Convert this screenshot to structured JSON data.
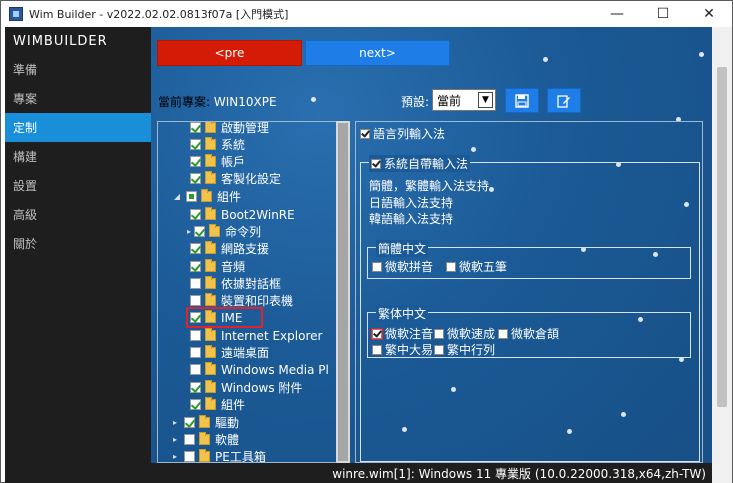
{
  "window": {
    "title": "Wim Builder - v2022.02.02.0813f07a [入門模式]",
    "controls": {
      "minimize": "—",
      "maximize": "☐",
      "close": "✕"
    }
  },
  "sidebar": {
    "brand": "WIMBUILDER",
    "items": [
      {
        "label": "準備",
        "active": false
      },
      {
        "label": "專案",
        "active": false
      },
      {
        "label": "定制",
        "active": true
      },
      {
        "label": "構建",
        "active": false
      },
      {
        "label": "設置",
        "active": false
      },
      {
        "label": "高級",
        "active": false
      },
      {
        "label": "關於",
        "active": false
      }
    ]
  },
  "toolbar": {
    "pre_label": "<pre",
    "next_label": "next>",
    "project_prefix": "當前專案:",
    "project_name": "WIN10XPE",
    "preset_label": "預設:",
    "preset_value": "當前",
    "save_icon": "save-icon",
    "edit_icon": "edit-icon"
  },
  "tree": {
    "items": [
      {
        "label": "啟動管理",
        "state": "checked"
      },
      {
        "label": "系統",
        "state": "checked"
      },
      {
        "label": "帳戶",
        "state": "checked"
      },
      {
        "label": "客製化設定",
        "state": "checked"
      },
      {
        "label": "組件",
        "state": "partial"
      },
      {
        "label": "Boot2WinRE",
        "state": "checked"
      },
      {
        "label": "命令列",
        "state": "checked"
      },
      {
        "label": "網路支援",
        "state": "checked"
      },
      {
        "label": "音頻",
        "state": "checked"
      },
      {
        "label": "依據對話框",
        "state": "unchecked"
      },
      {
        "label": "裝置和印表機",
        "state": "unchecked"
      },
      {
        "label": "IME",
        "state": "checked"
      },
      {
        "label": "Internet Explorer",
        "state": "unchecked"
      },
      {
        "label": "遠端桌面",
        "state": "unchecked"
      },
      {
        "label": "Windows Media Pl",
        "state": "unchecked"
      },
      {
        "label": "Windows 附件",
        "state": "checked"
      },
      {
        "label": "組件",
        "state": "checked"
      },
      {
        "label": "驅動",
        "state": "checked"
      },
      {
        "label": "軟體",
        "state": "unchecked"
      },
      {
        "label": "PE工具箱",
        "state": "unchecked"
      }
    ]
  },
  "ime_panel": {
    "main_option": "語言列輸入法",
    "builtin_group": "系統自帶輸入法",
    "notes": [
      "簡體，繁體輸入法支持",
      "日語輸入法支持",
      "韓語輸入法支持"
    ],
    "simplified_group": "簡體中文",
    "simplified_options": [
      "微軟拼音",
      "微軟五筆"
    ],
    "traditional_group": "繁体中文",
    "traditional_options": [
      "微軟注音",
      "微軟速成",
      "微軟倉頡",
      "繁中大易",
      "繁中行列"
    ]
  },
  "status": {
    "text": "winre.wim[1]: Windows 11 專業版 (10.0.22000.318,x64,zh-TW)"
  },
  "colors": {
    "pre_button": "#d41b05",
    "next_button": "#1e7de6",
    "nav_active": "#1a8fd9",
    "highlight": "#e0212e"
  }
}
